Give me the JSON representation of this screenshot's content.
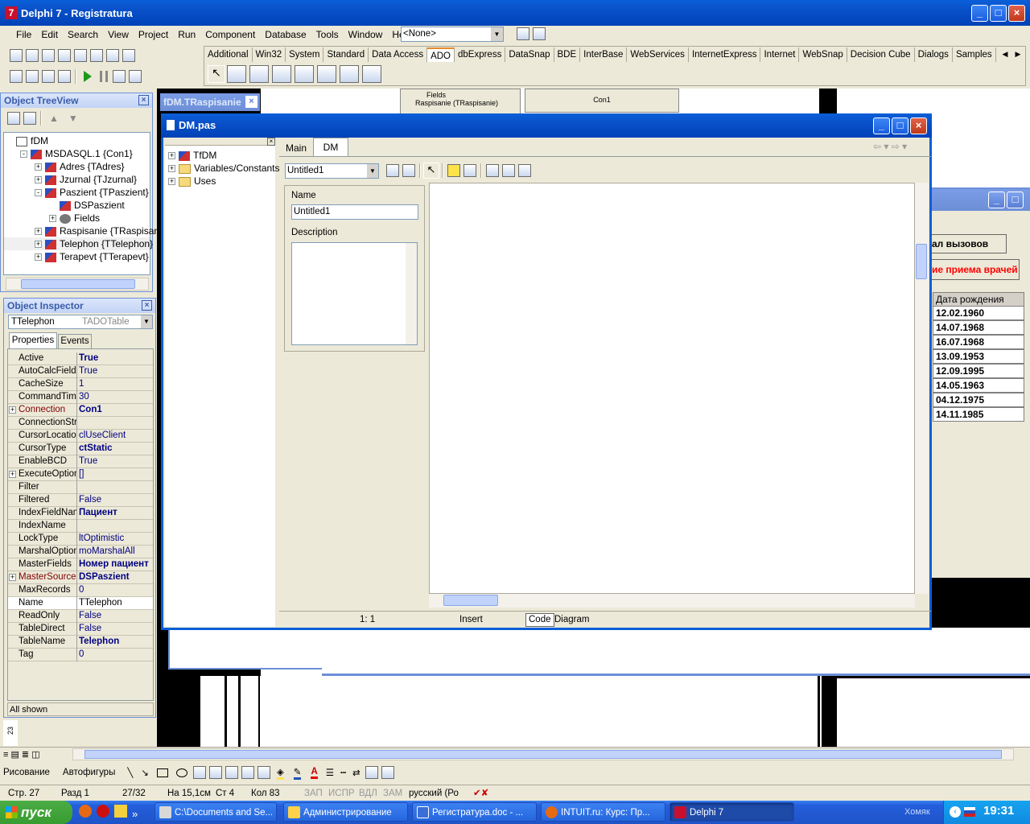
{
  "main_window": {
    "title": "Delphi 7 - Registratura"
  },
  "menu": [
    "File",
    "Edit",
    "Search",
    "View",
    "Project",
    "Run",
    "Component",
    "Database",
    "Tools",
    "Window",
    "Help"
  ],
  "desktop_combo": "<None>",
  "palette_tabs": [
    "Additional",
    "Win32",
    "System",
    "Standard",
    "Data Access",
    "ADO",
    "dbExpress",
    "DataSnap",
    "BDE",
    "InterBase",
    "WebServices",
    "InternetExpress",
    "Internet",
    "WebSnap",
    "Decision Cube",
    "Dialogs",
    "Samples"
  ],
  "palette_active": "ADO",
  "treeview": {
    "title": "Object TreeView",
    "items": [
      {
        "label": "fDM",
        "level": 0,
        "expander": "",
        "icon": "form"
      },
      {
        "label": "MSDASQL.1 {Con1}",
        "level": 1,
        "expander": "-",
        "icon": "db"
      },
      {
        "label": "Adres {TAdres}",
        "level": 2,
        "expander": "+",
        "icon": "db"
      },
      {
        "label": "Jzurnal {TJzurnal}",
        "level": 2,
        "expander": "+",
        "icon": "db"
      },
      {
        "label": "Paszient {TPaszient}",
        "level": 2,
        "expander": "-",
        "icon": "db"
      },
      {
        "label": "DSPaszient",
        "level": 3,
        "expander": "",
        "icon": "db"
      },
      {
        "label": "Fields",
        "level": 3,
        "expander": "+",
        "icon": "fields"
      },
      {
        "label": "Raspisanie {TRaspisanie}",
        "level": 2,
        "expander": "+",
        "icon": "db"
      },
      {
        "label": "Telephon {TTelephon}",
        "level": 2,
        "expander": "+",
        "icon": "db"
      },
      {
        "label": "Terapevt {TTerapevt}",
        "level": 2,
        "expander": "+",
        "icon": "db"
      }
    ]
  },
  "inspector": {
    "title": "Object Inspector",
    "object": "TTelephon",
    "object_type": "TADOTable",
    "tabs": [
      "Properties",
      "Events"
    ],
    "props": [
      {
        "k": "Active",
        "v": "True",
        "b": true
      },
      {
        "k": "AutoCalcFields",
        "v": "True"
      },
      {
        "k": "CacheSize",
        "v": "1"
      },
      {
        "k": "CommandTimeout",
        "v": "30"
      },
      {
        "k": "Connection",
        "v": "Con1",
        "b": true,
        "red": true,
        "plus": true
      },
      {
        "k": "ConnectionString",
        "v": ""
      },
      {
        "k": "CursorLocation",
        "v": "clUseClient"
      },
      {
        "k": "CursorType",
        "v": "ctStatic",
        "b": true
      },
      {
        "k": "EnableBCD",
        "v": "True"
      },
      {
        "k": "ExecuteOptions",
        "v": "[]",
        "plus": true
      },
      {
        "k": "Filter",
        "v": ""
      },
      {
        "k": "Filtered",
        "v": "False"
      },
      {
        "k": "IndexFieldNames",
        "v": "Пациент",
        "b": true
      },
      {
        "k": "IndexName",
        "v": ""
      },
      {
        "k": "LockType",
        "v": "ltOptimistic"
      },
      {
        "k": "MarshalOptions",
        "v": "moMarshalAll"
      },
      {
        "k": "MasterFields",
        "v": "Номер пациент",
        "b": true
      },
      {
        "k": "MasterSource",
        "v": "DSPaszient",
        "b": true,
        "red": true,
        "plus": true
      },
      {
        "k": "MaxRecords",
        "v": "0"
      },
      {
        "k": "Name",
        "v": "TTelephon",
        "sel": true
      },
      {
        "k": "ReadOnly",
        "v": "False"
      },
      {
        "k": "TableDirect",
        "v": "False"
      },
      {
        "k": "TableName",
        "v": "Telephon",
        "b": true
      },
      {
        "k": "Tag",
        "v": "0"
      }
    ],
    "status": "All shown"
  },
  "bg_form_title": "fDM.TRaspisanie",
  "bg_fields": "Fields",
  "bg_raspisanie": "Raspisanie (TRaspisanie)",
  "bg_con1": "Con1",
  "editor": {
    "title": "DM.pas",
    "tabs": [
      "Main",
      "DM"
    ],
    "explorer": [
      "TfDM",
      "Variables/Constants",
      "Uses"
    ],
    "diagram_combo": "Untitled1",
    "name_label": "Name",
    "name_value": "Untitled1",
    "desc_label": "Description",
    "status_pos": "1:   1",
    "status_mode": "Insert",
    "bottom_tabs": [
      "Code",
      "Diagram"
    ]
  },
  "right_form": {
    "btn1": "ал вызовов",
    "btn2": "ие приема врачей",
    "col_header": "Дата рождения",
    "dates": [
      "12.02.1960",
      "14.07.1968",
      "16.07.1968",
      "13.09.1953",
      "12.09.1995",
      "14.05.1963",
      "04.12.1975",
      "14.11.1985"
    ]
  },
  "word": {
    "draw_label": "Рисование",
    "autoshapes": "Автофигуры",
    "status": {
      "page": "Стр. 27",
      "section": "Разд 1",
      "pages": "27/32",
      "pos": "На 15,1см",
      "line": "Ст 4",
      "col": "Кол 83",
      "rec": "ЗАП",
      "trk": "ИСПР",
      "ext": "ВДЛ",
      "ovr": "ЗАМ",
      "lang": "русский (Ро"
    },
    "ruler": "23"
  },
  "taskbar": {
    "start": "пуск",
    "buttons": [
      "C:\\Documents and Se...",
      "Администрирование",
      "Регистратура.doc - ...",
      "INTUIT.ru: Курс: Пр...",
      "Delphi 7"
    ],
    "tray_user": "Хомяк",
    "time": "19:31"
  },
  "colors": {
    "xp_blue": "#0a5fd8",
    "face": "#ece9d8",
    "date_red": "#ff0000"
  }
}
